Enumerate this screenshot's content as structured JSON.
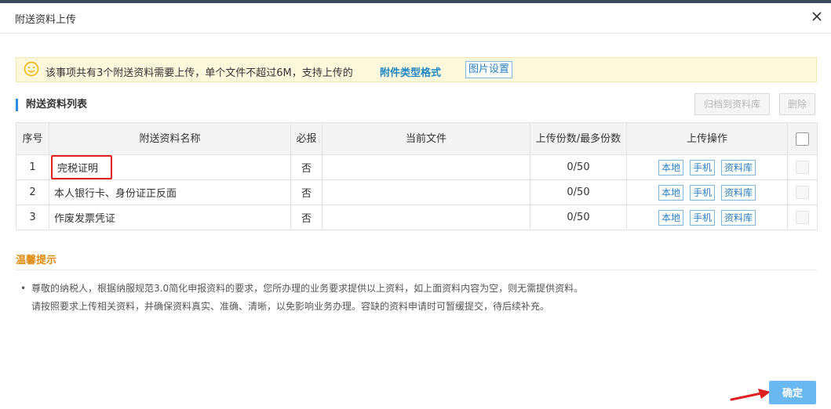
{
  "dialog": {
    "title": "附送资料上传",
    "close_icon": "close-icon"
  },
  "notice": {
    "icon": "smile-icon",
    "text": "该事项共有3个附送资料需要上传，单个文件不超过6M，支持上传的",
    "link": "附件类型格式",
    "image_settings": "图片设置"
  },
  "list": {
    "title": "附送资料列表",
    "archive_btn": "归档到资料库",
    "delete_btn": "删除",
    "headers": {
      "seq": "序号",
      "name": "附送资料名称",
      "required": "必报",
      "current_file": "当前文件",
      "count": "上传份数/最多份数",
      "ops": "上传操作"
    },
    "rows": [
      {
        "seq": "1",
        "name": "完税证明",
        "required": "否",
        "current_file": "",
        "count": "0/50"
      },
      {
        "seq": "2",
        "name": "本人银行卡、身份证正反面",
        "required": "否",
        "current_file": "",
        "count": "0/50"
      },
      {
        "seq": "3",
        "name": "作废发票凭证",
        "required": "否",
        "current_file": "",
        "count": "0/50"
      }
    ],
    "op_labels": {
      "local": "本地",
      "phone": "手机",
      "library": "资料库"
    }
  },
  "tips": {
    "title": "温馨提示",
    "line1": "尊敬的纳税人，根据纳服规范3.0简化申报资料的要求，您所办理的业务要求提供以上资料，如上面资料内容为空，则无需提供资料。",
    "line2": "请按照要求上传相关资料，并确保资料真实、准确、清晰，以免影响业务办理。容缺的资料申请时可暂缓提交，待后续补充。"
  },
  "footer": {
    "confirm": "确定"
  },
  "colors": {
    "accent": "#2b8de0",
    "highlight_border": "#e02020",
    "tip_title": "#e08a0a",
    "confirm_bg": "#6ab8f2"
  }
}
